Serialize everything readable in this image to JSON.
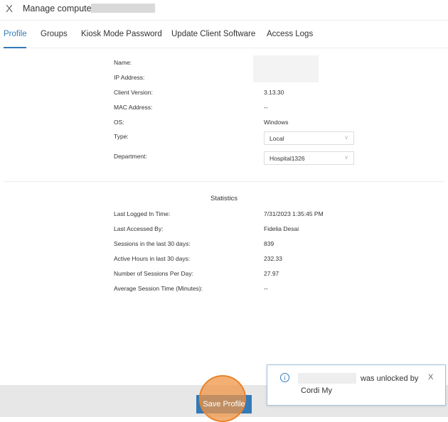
{
  "header": {
    "close_label": "X",
    "title": "Manage computer:"
  },
  "tabs": [
    {
      "label": "Profile"
    },
    {
      "label": "Groups"
    },
    {
      "label": "Kiosk Mode Password"
    },
    {
      "label": "Update Client Software"
    },
    {
      "label": "Access Logs"
    }
  ],
  "profile": {
    "name": {
      "label": "Name:",
      "value": ""
    },
    "ip": {
      "label": "IP Address:",
      "value": ""
    },
    "client_version": {
      "label": "Client Version:",
      "value": "3.13.30"
    },
    "mac": {
      "label": "MAC Address:",
      "value": "--"
    },
    "os": {
      "label": "OS:",
      "value": "Windows"
    },
    "type": {
      "label": "Type:",
      "selected": "Local"
    },
    "department": {
      "label": "Department:",
      "selected": "Hospital1326"
    }
  },
  "statistics": {
    "title": "Statistics",
    "rows": [
      {
        "label": "Last Logged In Time:",
        "value": "7/31/2023 1:35:45 PM"
      },
      {
        "label": "Last Accessed By:",
        "value": "Fidelia Desai"
      },
      {
        "label": "Sessions in the last 30 days:",
        "value": "839"
      },
      {
        "label": "Active Hours in last 30 days:",
        "value": "232.33"
      },
      {
        "label": "Number of Sessions Per Day:",
        "value": "27.97"
      },
      {
        "label": "Average Session Time (Minutes):",
        "value": "--"
      }
    ]
  },
  "footer": {
    "save_label": "Save Profile"
  },
  "toast": {
    "icon": "info-icon",
    "icon_glyph": "i",
    "message": "was unlocked by",
    "user": "Cordi My",
    "close_label": "X"
  },
  "colors": {
    "accent": "#337ab7",
    "highlight": "#e8842d"
  }
}
